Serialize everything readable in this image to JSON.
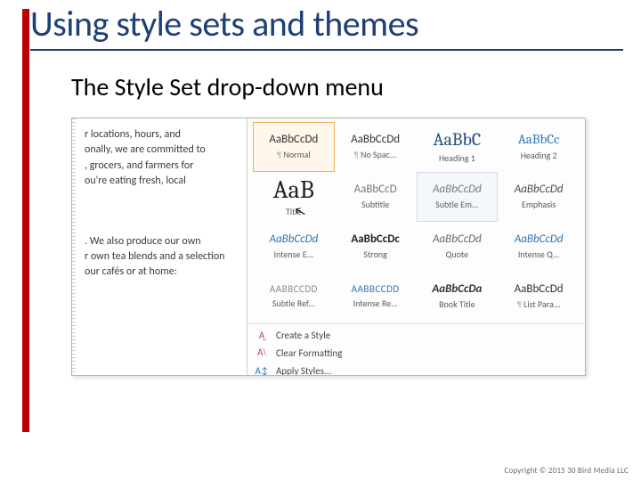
{
  "slide": {
    "title": "Using style sets and themes",
    "sub_heading": "The Style Set drop-down menu"
  },
  "document_preview": {
    "para1": "r locations, hours, and\nonally, we are committed to\n, grocers, and farmers for\nou're eating fresh, local",
    "para2": ". We also produce our own\nr own tea blends and a selection\nour cafés or at home:"
  },
  "styles_gallery": {
    "sample_text_long": "AaBbCcDd",
    "sample_text_med": "AaBbCc",
    "sample_text_short": "AaBbC",
    "sample_text_title": "AaB",
    "sample_text_smallcaps": "AABBCCDD",
    "tiles": [
      {
        "key": "normal",
        "label": "¶ Normal",
        "sample": "AaBbCcDd",
        "sample_class": "samp-normal",
        "selected": true
      },
      {
        "key": "nospacing",
        "label": "¶ No Spac...",
        "sample": "AaBbCcDd",
        "sample_class": "samp-nospac"
      },
      {
        "key": "heading1",
        "label": "Heading 1",
        "sample": "AaBbC",
        "sample_class": "samp-heading1"
      },
      {
        "key": "heading2",
        "label": "Heading 2",
        "sample": "AaBbCc",
        "sample_class": "samp-heading2"
      },
      {
        "key": "title",
        "label": "Title",
        "sample": "AaB",
        "sample_class": "samp-title"
      },
      {
        "key": "subtitle",
        "label": "Subtitle",
        "sample": "AaBbCcD",
        "sample_class": "samp-subtitle"
      },
      {
        "key": "subtleem",
        "label": "Subtle Em...",
        "sample": "AaBbCcDd",
        "sample_class": "samp-subtleem",
        "hover": true
      },
      {
        "key": "emphasis",
        "label": "Emphasis",
        "sample": "AaBbCcDd",
        "sample_class": "samp-emphasis"
      },
      {
        "key": "intensee",
        "label": "Intense E...",
        "sample": "AaBbCcDd",
        "sample_class": "samp-intensee"
      },
      {
        "key": "strong",
        "label": "Strong",
        "sample": "AaBbCcDc",
        "sample_class": "samp-strong"
      },
      {
        "key": "quote",
        "label": "Quote",
        "sample": "AaBbCcDd",
        "sample_class": "samp-quote"
      },
      {
        "key": "intenseq",
        "label": "Intense Q...",
        "sample": "AaBbCcDd",
        "sample_class": "samp-intenseq"
      },
      {
        "key": "subtleref",
        "label": "Subtle Ref...",
        "sample": "AABBCCDD",
        "sample_class": "samp-subtref"
      },
      {
        "key": "intref",
        "label": "Intense Re...",
        "sample": "AABBCCDD",
        "sample_class": "samp-intref"
      },
      {
        "key": "booktitle",
        "label": "Book Title",
        "sample": "AaBbCcDa",
        "sample_class": "samp-book"
      },
      {
        "key": "listpara",
        "label": "¶ List Para...",
        "sample": "AaBbCcDd",
        "sample_class": "samp-listpara"
      }
    ]
  },
  "footer_commands": {
    "create_style": "Create a Style",
    "clear_formatting": "Clear Formatting",
    "apply_styles": "Apply Styles..."
  },
  "copyright": "Copyright © 2015 30 Bird Media LLC"
}
